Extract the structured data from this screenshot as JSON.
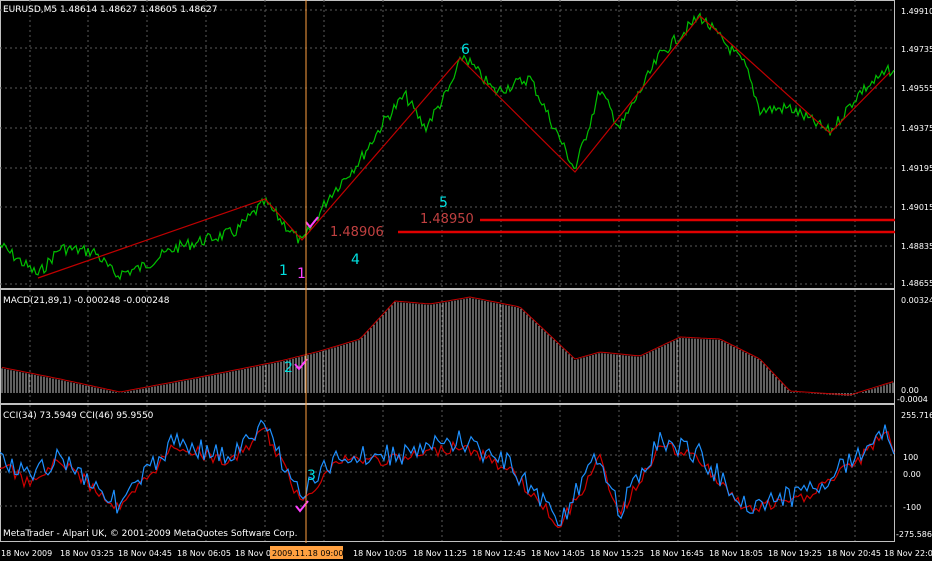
{
  "main": {
    "symbol_header": "EURUSD,M5  1.48614 1.48627 1.48605 1.48627",
    "price_labels": [
      "1.49910",
      "1.49735",
      "1.49555",
      "1.49375",
      "1.49195",
      "1.49015",
      "1.48835",
      "1.48655"
    ],
    "level_labels": [
      "1.48906",
      "1.48950"
    ],
    "markers": [
      "1",
      "1",
      "4",
      "5",
      "6"
    ]
  },
  "macd": {
    "header": "MACD(21,89,1) -0.000248 -0.000248",
    "scale_labels": [
      "0.00324",
      "0.00",
      "-0.0004"
    ],
    "markers": [
      "2"
    ]
  },
  "cci": {
    "header": "CCI(34) 73.5949  CCI(46) 95.9550",
    "scale_labels": [
      "255.716",
      "100",
      "0.00",
      "-100",
      "-275.586"
    ],
    "markers": [
      "3"
    ]
  },
  "watermark": "MetaTrader - Alpari UK, © 2001-2009 MetaQuotes Software Corp.",
  "time_axis": {
    "labels": [
      "18 Nov 2009",
      "18 Nov 03:25",
      "18 Nov 04:45",
      "18 Nov 06:05",
      "18 Nov 0",
      "18 Nov 10:05",
      "18 Nov 11:25",
      "18 Nov 12:45",
      "18 Nov 14:05",
      "18 Nov 15:25",
      "18 Nov 16:45",
      "18 Nov 18:05",
      "18 Nov 19:25",
      "18 Nov 20:45",
      "18 Nov 22:05"
    ],
    "crosshair_time": "2009.11.18 09:00"
  },
  "colors": {
    "background": "#000000",
    "candles": "#00c000",
    "zigzag": "#c00000",
    "levels": "#e00000",
    "macd_hist": "#c0c0c0",
    "macd_signal": "#c00000",
    "cci_fast": "#1e90ff",
    "cci_slow": "#d00000",
    "marker_cyan": "#00e0e0",
    "marker_magenta": "#ff40ff",
    "crosshair": "#ffa040"
  }
}
